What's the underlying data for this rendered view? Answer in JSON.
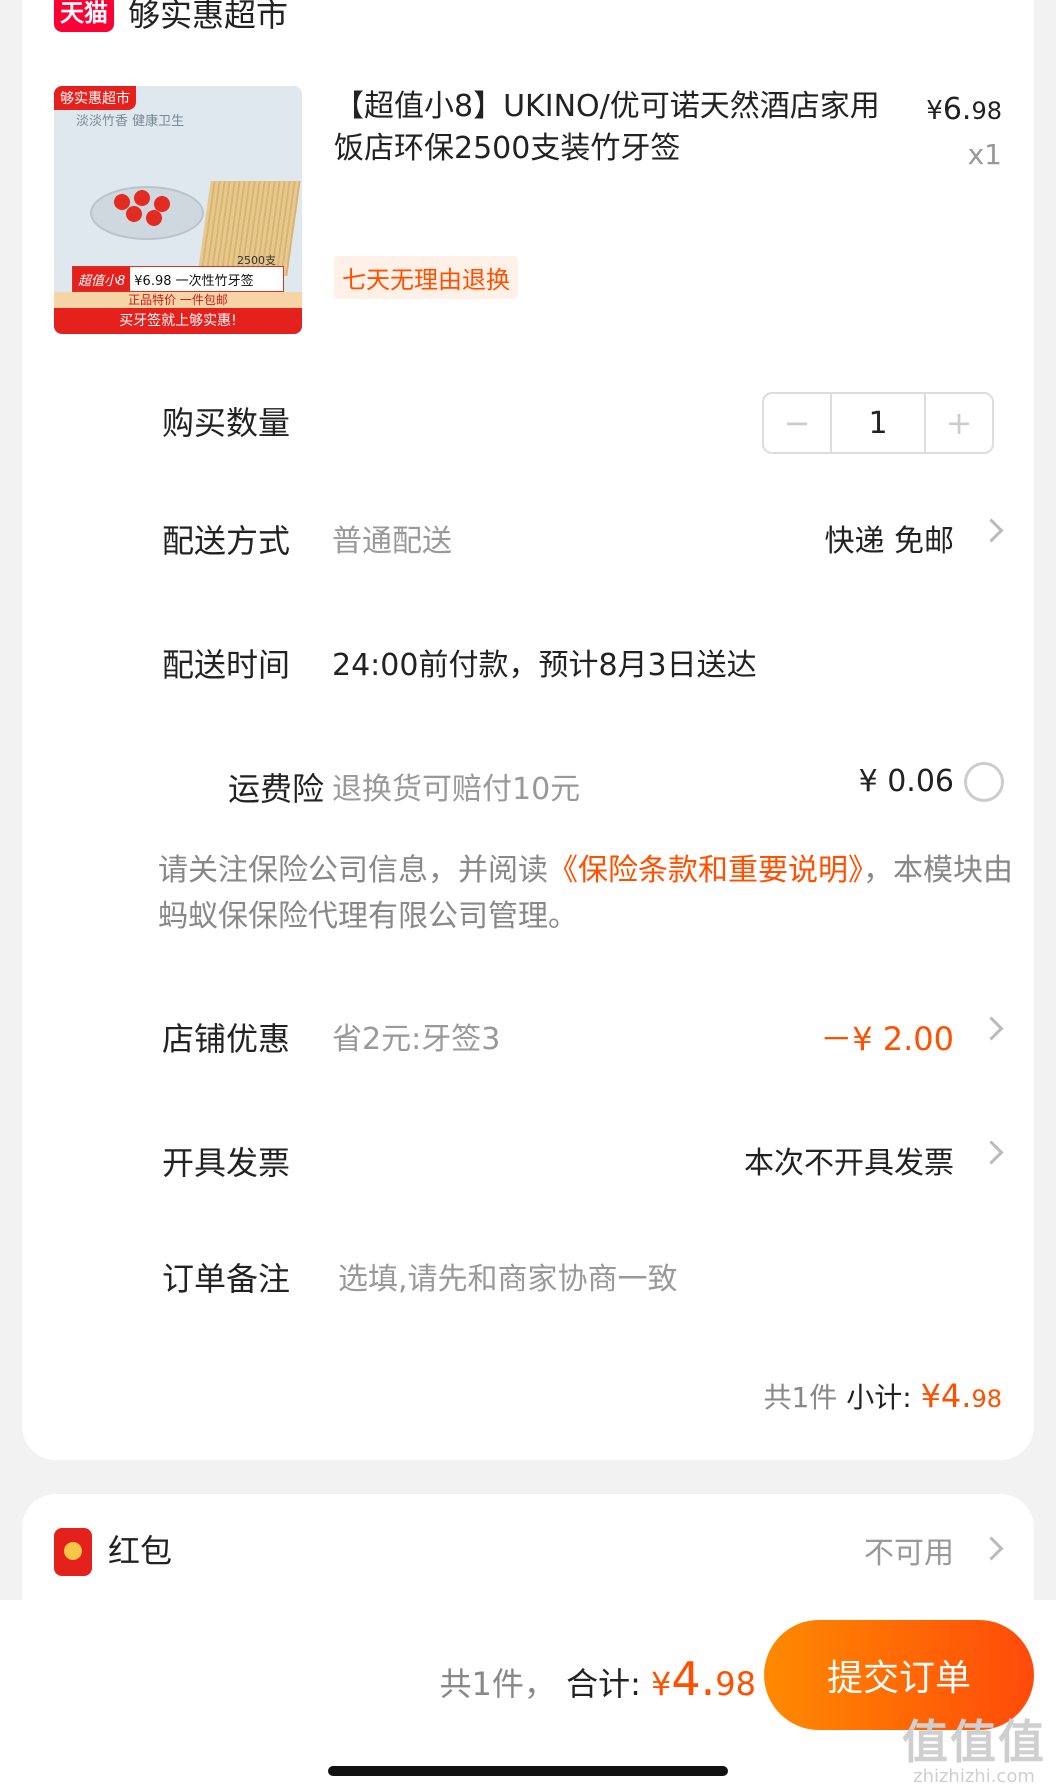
{
  "shop": {
    "badge": "天猫",
    "name": "够实惠超市"
  },
  "product": {
    "image_texts": {
      "top_tag": "够实惠超市",
      "slogan": "淡淡竹香 健康卫生",
      "count": "2500支",
      "price_label": "超值小8",
      "price_text": "¥6.98 一次性竹牙签",
      "sub_band": "正品特价 一件包邮",
      "bottom_band": "买牙签就上够实惠!"
    },
    "title": "【超值小8】UKINO/优可诺天然酒店家用饭店环保2500支装竹牙签",
    "price_yen": "¥",
    "price_int": "6.",
    "price_dec": "98",
    "qty_x": "x1",
    "return_tag": "七天无理由退换"
  },
  "quantity": {
    "label": "购买数量",
    "minus": "−",
    "value": "1",
    "plus": "+"
  },
  "delivery": {
    "label": "配送方式",
    "value": "普通配送",
    "right": "快递 免邮"
  },
  "delivery_time": {
    "label": "配送时间",
    "value": "24:00前付款，预计8月3日送达"
  },
  "insurance": {
    "label": "运费险",
    "value": "退换货可赔付10元",
    "price": "¥ 0.06"
  },
  "notice": {
    "prefix": "请关注保险公司信息，并阅读",
    "link": "《保险条款和重要说明》",
    "suffix": "，本模块由蚂蚁保保险代理有限公司管理。"
  },
  "shop_discount": {
    "label": "店铺优惠",
    "value": "省2元:牙签3",
    "amount": "－¥ 2.00"
  },
  "invoice": {
    "label": "开具发票",
    "value": "本次不开具发票"
  },
  "remark": {
    "label": "订单备注",
    "placeholder": "选填,请先和商家协商一致"
  },
  "subtotal": {
    "count": "共1件",
    "label": "小计:",
    "yen": "¥",
    "int": "4.",
    "dec": "98"
  },
  "red_packet": {
    "label": "红包",
    "status": "不可用"
  },
  "bottom_bar": {
    "count": "共1件，",
    "label": "合计:",
    "yen": "¥",
    "int": "4.",
    "dec": "98",
    "submit": "提交订单"
  },
  "watermark": {
    "main": "值值值",
    "sub": "zhizhizhi.com"
  },
  "colors": {
    "accent": "#ff5000",
    "tmall_red": "#ff0036",
    "submit_gradient_start": "#ff8a00",
    "submit_gradient_end": "#ff4b0a"
  }
}
